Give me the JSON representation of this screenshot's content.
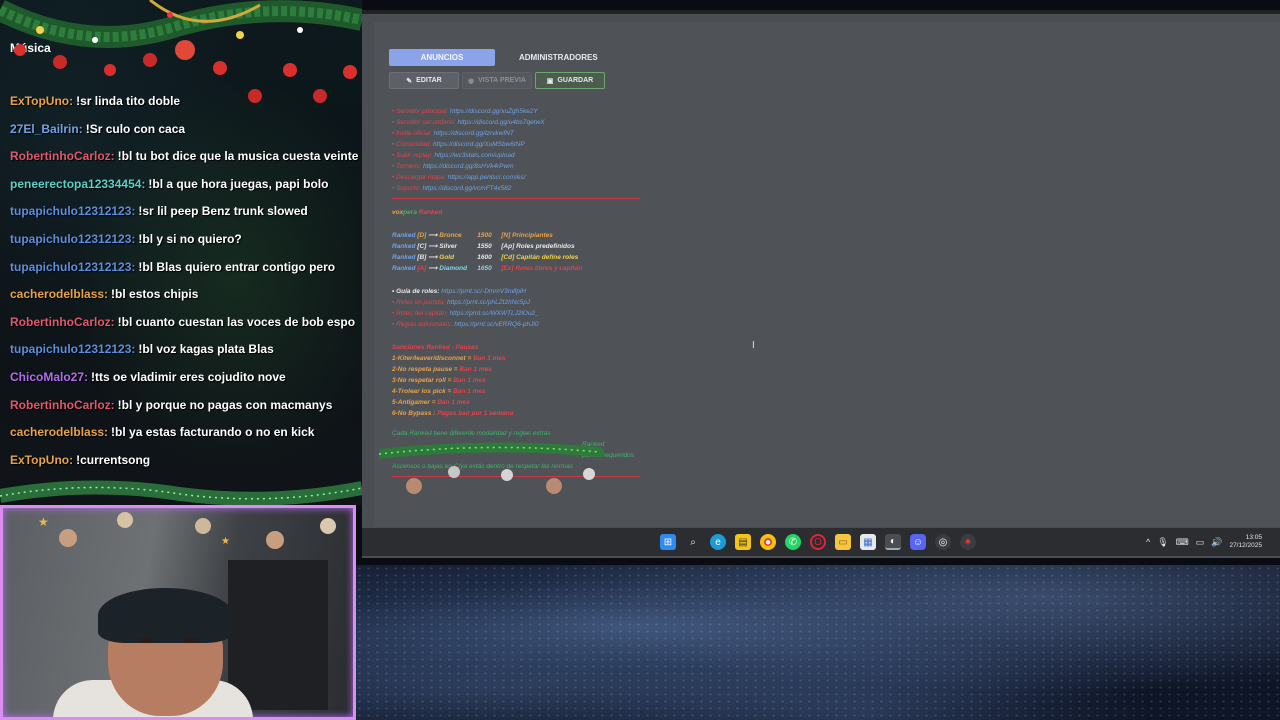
{
  "chat": {
    "title": "Música",
    "messages": [
      {
        "user": "ExTopUno:",
        "text": "!sr linda tito doble",
        "color": "#e8a24a"
      },
      {
        "user": "27El_Bailrin:",
        "text": "!Sr culo con caca",
        "color": "#6fa3e6"
      },
      {
        "user": "RobertinhoCarloz:",
        "text": "!bl tu bot dice que la musica cuesta veinte",
        "color": "#e0586a"
      },
      {
        "user": "peneerectopa12334454:",
        "text": "!bl a que hora juegas, papi bolo",
        "color": "#5cd0c6"
      },
      {
        "user": "tupapichulo12312123:",
        "text": "!sr lil peep Benz trunk slowed",
        "color": "#5b8fe0"
      },
      {
        "user": "tupapichulo12312123:",
        "text": "!bl y si no quiero?",
        "color": "#5b8fe0"
      },
      {
        "user": "tupapichulo12312123:",
        "text": "!bl Blas quiero entrar contigo pero",
        "color": "#5b8fe0"
      },
      {
        "user": "cacherodelblass:",
        "text": "!bl estos chipis",
        "color": "#e8a24a"
      },
      {
        "user": "RobertinhoCarloz:",
        "text": "!bl cuanto cuestan las voces de bob espo",
        "color": "#e0586a"
      },
      {
        "user": "tupapichulo12312123:",
        "text": "!bl voz kagas plata Blas",
        "color": "#5b8fe0"
      },
      {
        "user": "ChicoMalo27:",
        "text": "!tts oe vladimir eres cojudito nove",
        "color": "#b36cf0"
      },
      {
        "user": "RobertinhoCarloz:",
        "text": "!bl y porque no pagas con macmanys",
        "color": "#e0586a"
      },
      {
        "user": "cacherodelblass:",
        "text": "!bl ya estas facturando o no en kick",
        "color": "#e8a24a"
      },
      {
        "user": "ExTopUno:",
        "text": "!currentsong",
        "color": "#e8a24a"
      }
    ]
  },
  "panel": {
    "tabs": [
      {
        "label": "ANUNCIOS",
        "active": true
      },
      {
        "label": "ADMINISTRADORES",
        "active": false
      }
    ],
    "toolbar": {
      "edit_label": "EDITAR",
      "preview_label": "VISTA PREVIA",
      "save_label": "GUARDAR"
    },
    "links": [
      {
        "name": "Servidor principal:",
        "url": "https://discord.gg/xuZgh5ke2Y"
      },
      {
        "name": "Servidor secundario:",
        "url": "https://discord.gg/u4bs7qetwX"
      },
      {
        "name": "Invite oficial:",
        "url": "https://discord.gg/tzrvkwfNT"
      },
      {
        "name": "Comunidad:",
        "url": "https://discord.gg/XuMSbw6tNP"
      },
      {
        "name": "Subir replay:",
        "url": "https://wc3stats.com/upload"
      },
      {
        "name": "Torneos:",
        "url": "https://discord.gg/8sHVk4rPwm"
      },
      {
        "name": "Descargar mapa:",
        "url": "https://app.pentscr.com/es/"
      },
      {
        "name": "Soporte:",
        "url": "https://discord.gg/vcmFT4x582"
      }
    ],
    "heading": {
      "prefix": "vox",
      "mid": "pera",
      "suffix": "Ranked"
    },
    "ranks": [
      {
        "label": "Ranked",
        "tier": "[D]",
        "name": "Bronce",
        "mmr": "1500",
        "role": "[N] Principiantes",
        "tier_class": "orange",
        "name_class": "orange",
        "role_class": "orange"
      },
      {
        "label": "Ranked",
        "tier": "[C]",
        "name": "Silver",
        "mmr": "1550",
        "role": "[Ap] Roles predefinidos",
        "tier_class": "white",
        "name_class": "white",
        "role_class": "white"
      },
      {
        "label": "Ranked",
        "tier": "[B]",
        "name": "Gold",
        "mmr": "1600",
        "role": "[Cd] Capitán define roles",
        "tier_class": "white",
        "name_class": "yellow",
        "role_class": "yellow"
      },
      {
        "label": "Ranked",
        "tier": "[A]",
        "name": "Diamond",
        "mmr": "1650",
        "role": "[Ex] Roles libres y capitán",
        "tier_class": "red",
        "name_class": "cyan",
        "role_class": "red"
      }
    ],
    "guides": [
      {
        "name": "Guía de roles:",
        "url": "https://prnt.sc/-DmmV3mlfplH"
      },
      {
        "name": "Roles en partida:",
        "url": "https://prnt.sc/phLZt2hNc5pJ"
      },
      {
        "name": "Roles del capitán:",
        "url": "https://prnt.sc/WXWTLJ2lOu2_"
      },
      {
        "name": "Reglas adicionales:",
        "url": "https://prnt.sc/vERRQ6-phJl0"
      }
    ],
    "penalties_title": "Sanciones Ranked - Pausas",
    "penalties": [
      {
        "rule": "1-Kiter/leaver/disconnet =",
        "penalty": "Ban 1 mes"
      },
      {
        "rule": "2-No respeta pause =",
        "penalty": "Ban 1 mes"
      },
      {
        "rule": "3-No respetar roll =",
        "penalty": "Ban 1 mes"
      },
      {
        "rule": "4-Trolear los pick =",
        "penalty": "Ban 1 mes"
      },
      {
        "rule": "5-Antigamer =",
        "penalty": "Ban 1 mes"
      },
      {
        "rule": "6-No Bypass :",
        "penalty": "Pagas ban por 1 semana"
      }
    ],
    "notes": [
      "Cada Ranked tiene diferente modalidad y reglas extras",
      "Ranked",
      "puntos requeridos",
      "Ascensos o bajas en C/ya estás dentro de respetar las normas"
    ]
  },
  "taskbar": {
    "time": "13:05",
    "date": "27/12/2025"
  }
}
